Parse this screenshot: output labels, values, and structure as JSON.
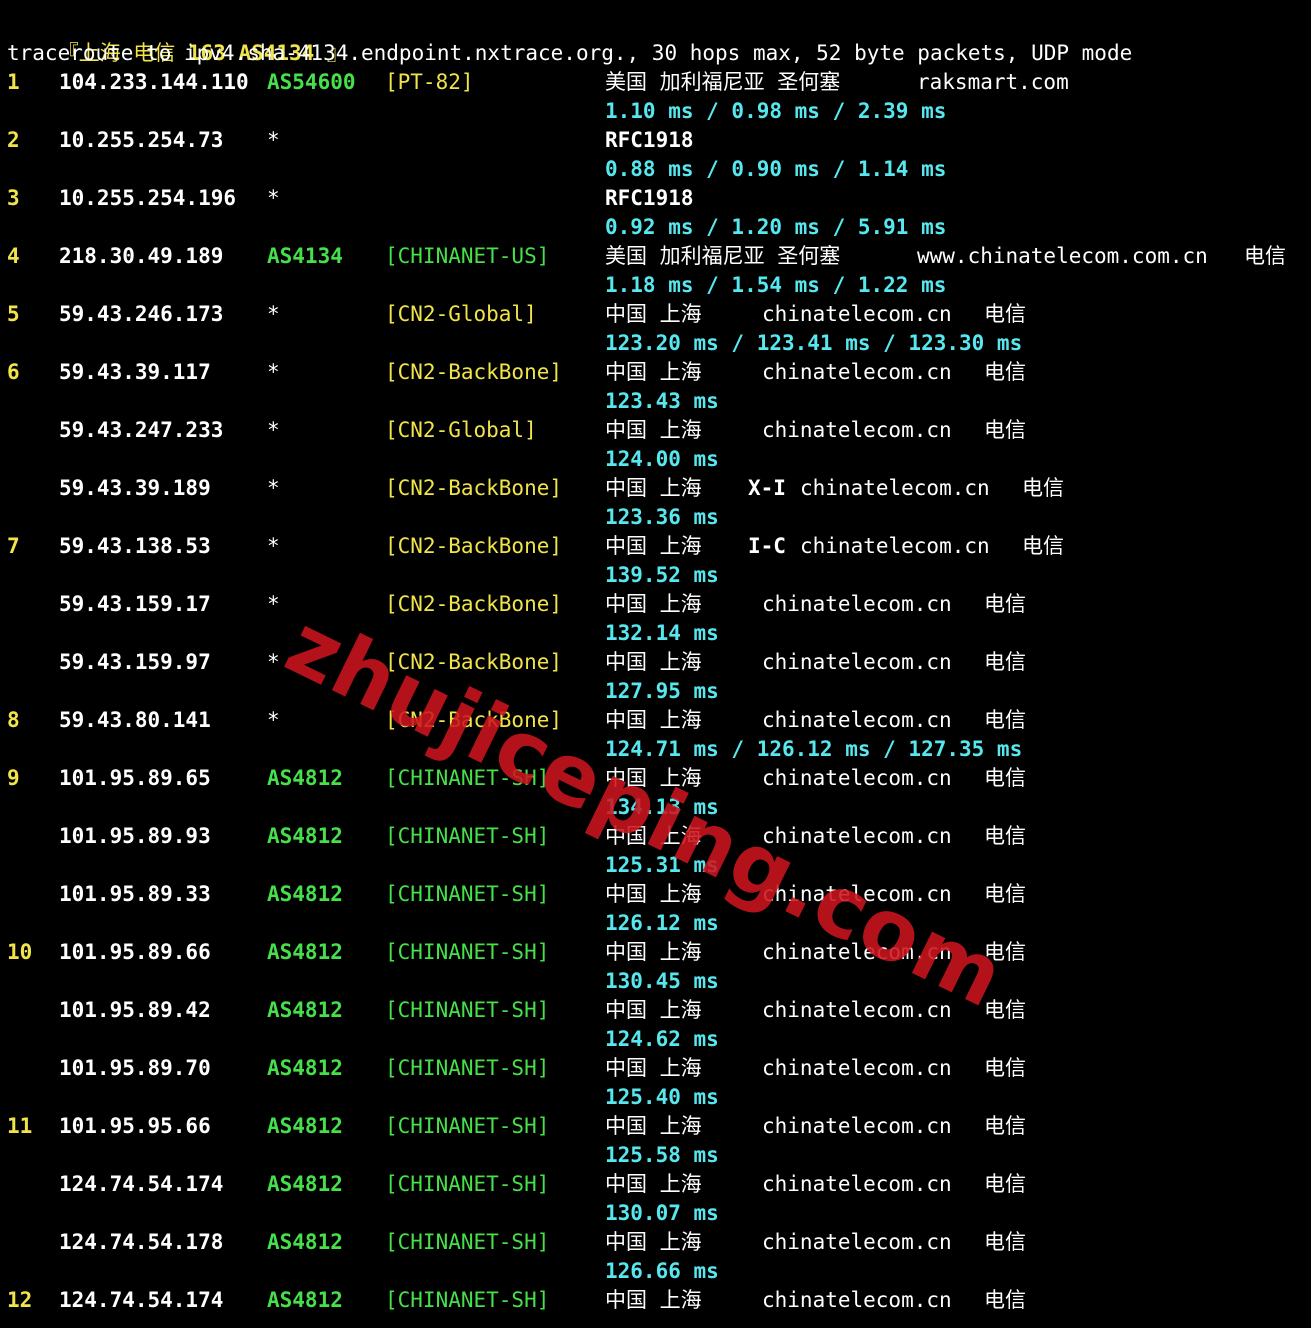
{
  "header": {
    "bracket_open": "『",
    "region": "上海 电信",
    "suffix": "163 AS4134",
    "bracket_close": "』"
  },
  "command_line": "traceroute to ipv4.sha-4134.endpoint.nxtrace.org., 30 hops max, 52 byte packets, UDP mode",
  "rows": [
    {
      "hop": "1",
      "ip": "104.233.144.110",
      "asn": "AS54600",
      "net": "[PT-82]",
      "geo": "美国 加利福尼亚 圣何塞",
      "host": "raksmart.com",
      "isp": ""
    },
    {
      "hop": "2",
      "ip": "10.255.254.73",
      "asn": "*",
      "net": "",
      "geo": "",
      "host": "RFC1918",
      "isp": ""
    },
    {
      "hop": "3",
      "ip": "10.255.254.196",
      "asn": "*",
      "net": "",
      "geo": "",
      "host": "RFC1918",
      "isp": ""
    },
    {
      "hop": "4",
      "ip": "218.30.49.189",
      "asn": "AS4134",
      "net": "[CHINANET-US]",
      "geo": "美国 加利福尼亚 圣何塞",
      "host": "www.chinatelecom.com.cn",
      "isp": "电信"
    },
    {
      "hop": "5",
      "ip": "59.43.246.173",
      "asn": "*",
      "net": "[CN2-Global]",
      "geo": "中国 上海",
      "host": "chinatelecom.cn",
      "isp": "电信"
    },
    {
      "hop": "6",
      "ip": "59.43.39.117",
      "asn": "*",
      "net": "[CN2-BackBone]",
      "geo": "中国 上海",
      "host": "chinatelecom.cn",
      "isp": "电信"
    },
    {
      "hop": "",
      "ip": "59.43.247.233",
      "asn": "*",
      "net": "[CN2-Global]",
      "geo": "中国 上海",
      "host": "chinatelecom.cn",
      "isp": "电信"
    },
    {
      "hop": "",
      "ip": "59.43.39.189",
      "asn": "*",
      "net": "[CN2-BackBone]",
      "geo": "中国 上海",
      "tag": "X-I",
      "host": "chinatelecom.cn",
      "isp": "电信"
    },
    {
      "hop": "7",
      "ip": "59.43.138.53",
      "asn": "*",
      "net": "[CN2-BackBone]",
      "geo": "中国 上海",
      "tag": "I-C",
      "host": "chinatelecom.cn",
      "isp": "电信"
    },
    {
      "hop": "",
      "ip": "59.43.159.17",
      "asn": "*",
      "net": "[CN2-BackBone]",
      "geo": "中国 上海",
      "host": "chinatelecom.cn",
      "isp": "电信"
    },
    {
      "hop": "",
      "ip": "59.43.159.97",
      "asn": "*",
      "net": "[CN2-BackBone]",
      "geo": "中国 上海",
      "host": "chinatelecom.cn",
      "isp": "电信"
    },
    {
      "hop": "8",
      "ip": "59.43.80.141",
      "asn": "*",
      "net": "[CN2-BackBone]",
      "geo": "中国 上海",
      "host": "chinatelecom.cn",
      "isp": "电信"
    },
    {
      "hop": "9",
      "ip": "101.95.89.65",
      "asn": "AS4812",
      "net": "[CHINANET-SH]",
      "geo": "中国 上海",
      "host": "chinatelecom.cn",
      "isp": "电信"
    },
    {
      "hop": "",
      "ip": "101.95.89.93",
      "asn": "AS4812",
      "net": "[CHINANET-SH]",
      "geo": "中国 上海",
      "host": "chinatelecom.cn",
      "isp": "电信"
    },
    {
      "hop": "",
      "ip": "101.95.89.33",
      "asn": "AS4812",
      "net": "[CHINANET-SH]",
      "geo": "中国 上海",
      "host": "chinatelecom.cn",
      "isp": "电信"
    },
    {
      "hop": "10",
      "ip": "101.95.89.66",
      "asn": "AS4812",
      "net": "[CHINANET-SH]",
      "geo": "中国 上海",
      "host": "chinatelecom.cn",
      "isp": "电信"
    },
    {
      "hop": "",
      "ip": "101.95.89.42",
      "asn": "AS4812",
      "net": "[CHINANET-SH]",
      "geo": "中国 上海",
      "host": "chinatelecom.cn",
      "isp": "电信"
    },
    {
      "hop": "",
      "ip": "101.95.89.70",
      "asn": "AS4812",
      "net": "[CHINANET-SH]",
      "geo": "中国 上海",
      "host": "chinatelecom.cn",
      "isp": "电信"
    },
    {
      "hop": "11",
      "ip": "101.95.95.66",
      "asn": "AS4812",
      "net": "[CHINANET-SH]",
      "geo": "中国 上海",
      "host": "chinatelecom.cn",
      "isp": "电信"
    },
    {
      "hop": "",
      "ip": "124.74.54.174",
      "asn": "AS4812",
      "net": "[CHINANET-SH]",
      "geo": "中国 上海",
      "host": "chinatelecom.cn",
      "isp": "电信"
    },
    {
      "hop": "",
      "ip": "124.74.54.178",
      "asn": "AS4812",
      "net": "[CHINANET-SH]",
      "geo": "中国 上海",
      "host": "chinatelecom.cn",
      "isp": "电信"
    },
    {
      "hop": "12",
      "ip": "124.74.54.174",
      "asn": "AS4812",
      "net": "[CHINANET-SH]",
      "geo": "中国 上海",
      "host": "chinatelecom.cn",
      "isp": "电信"
    }
  ],
  "latencies": [
    "1.10 ms / 0.98 ms / 2.39 ms",
    "0.88 ms / 0.90 ms / 1.14 ms",
    "0.92 ms / 1.20 ms / 5.91 ms",
    "1.18 ms / 1.54 ms / 1.22 ms",
    "123.20 ms / 123.41 ms / 123.30 ms",
    "123.43 ms",
    "124.00 ms",
    "123.36 ms",
    "139.52 ms",
    "132.14 ms",
    "127.95 ms",
    "124.71 ms / 126.12 ms / 127.35 ms",
    "134.13 ms",
    "125.31 ms",
    "126.12 ms",
    "130.45 ms",
    "124.62 ms",
    "125.40 ms",
    "125.58 ms",
    "130.07 ms",
    "126.66 ms"
  ],
  "watermark": "zhujiceping.com",
  "colors": {
    "background": "#000000",
    "hop_number": "#f0e44a",
    "asn": "#46e04a",
    "net_tag": "#f0e44a",
    "latency": "#57e7ef",
    "watermark": "#cd141e"
  }
}
